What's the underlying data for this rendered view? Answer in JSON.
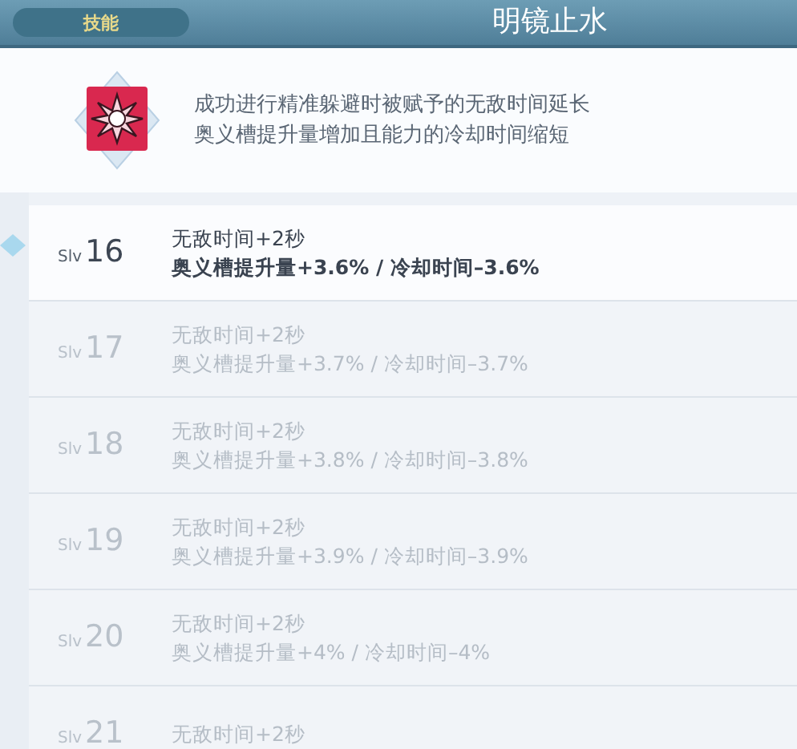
{
  "header": {
    "tab": "技能",
    "title": "明镜止水"
  },
  "skill": {
    "description": [
      "成功进行精准躲避时被赋予的无敌时间延长",
      "奥义槽提升量增加且能力的冷却时间缩短"
    ]
  },
  "levels": [
    {
      "prefix": "Slv",
      "level": "16",
      "lines": [
        "无敌时间+2秒",
        "奥义槽提升量+3.6% / 冷却时间–3.6%"
      ],
      "selected": true
    },
    {
      "prefix": "Slv",
      "level": "17",
      "lines": [
        "无敌时间+2秒",
        "奥义槽提升量+3.7% / 冷却时间–3.7%"
      ],
      "selected": false
    },
    {
      "prefix": "Slv",
      "level": "18",
      "lines": [
        "无敌时间+2秒",
        "奥义槽提升量+3.8% / 冷却时间–3.8%"
      ],
      "selected": false
    },
    {
      "prefix": "Slv",
      "level": "19",
      "lines": [
        "无敌时间+2秒",
        "奥义槽提升量+3.9% / 冷却时间–3.9%"
      ],
      "selected": false
    },
    {
      "prefix": "Slv",
      "level": "20",
      "lines": [
        "无敌时间+2秒",
        "奥义槽提升量+4% / 冷却时间–4%"
      ],
      "selected": false
    },
    {
      "prefix": "Slv",
      "level": "21",
      "lines": [
        "无敌时间+2秒"
      ],
      "selected": false
    }
  ]
}
